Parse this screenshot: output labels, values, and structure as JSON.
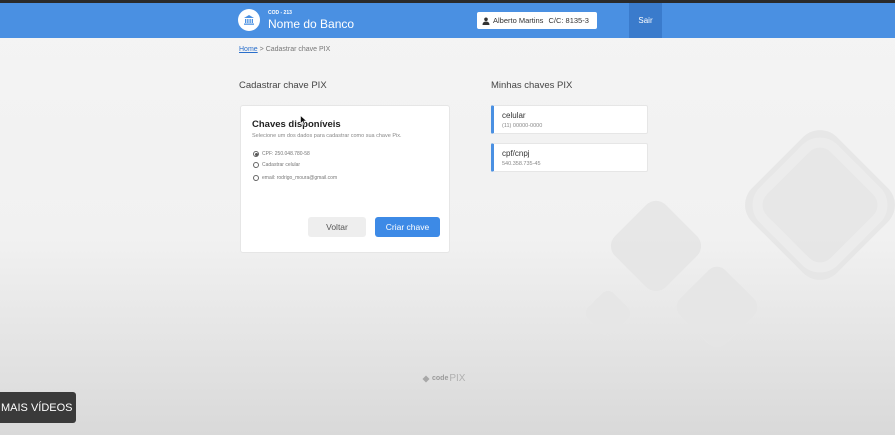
{
  "header": {
    "bank_code": "COD - 213",
    "bank_name": "Nome do Banco",
    "user_name": "Alberto Martins",
    "account": "C/C: 8135-3",
    "logout_label": "Sair",
    "bar_color": "#4a90e2"
  },
  "breadcrumb": {
    "home": "Home",
    "separator": ">",
    "current": "Cadastrar chave PIX"
  },
  "register": {
    "section_title": "Cadastrar chave PIX",
    "card_title": "Chaves disponíveis",
    "card_subtitle": "Selecione um dos dados para cadastrar como sua chave Pix.",
    "options": [
      {
        "label": "CPF: 250.048.780-58",
        "selected": true
      },
      {
        "label": "Cadastrar celular",
        "selected": false
      },
      {
        "label": "email: rodrigo_moura@gmail.com",
        "selected": false
      }
    ],
    "back_label": "Voltar",
    "create_label": "Criar chave",
    "accent_color": "#3d8ae6"
  },
  "my_keys": {
    "section_title": "Minhas chaves PIX",
    "keys": [
      {
        "type": "celular",
        "value": "(11) 00000-0000"
      },
      {
        "type": "cpf/cnpj",
        "value": "540.358.735-45"
      }
    ]
  },
  "footer": {
    "logo_code": "code",
    "logo_pix": "PIX"
  },
  "overlay": {
    "more_videos": "MAIS VÍDEOS"
  }
}
